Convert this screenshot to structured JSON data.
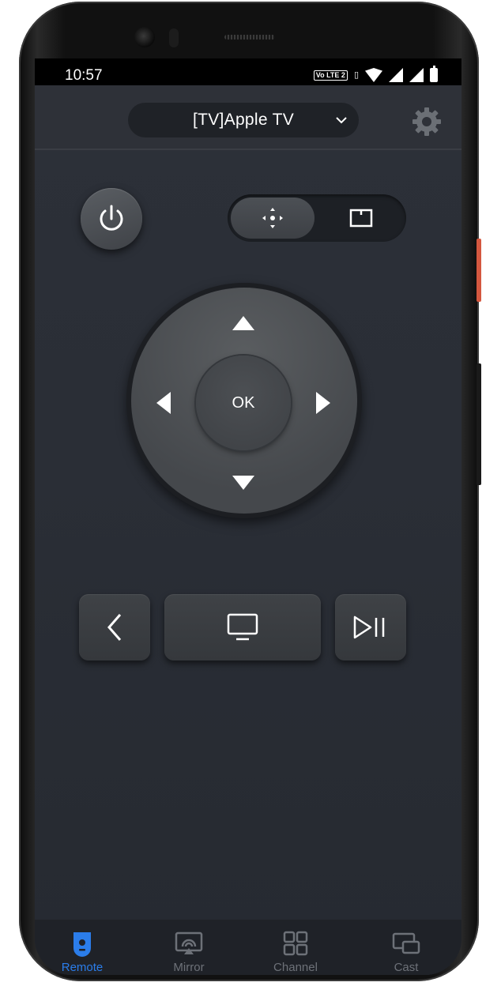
{
  "status_bar": {
    "time": "10:57",
    "volte": "Vo LTE 2"
  },
  "header": {
    "device_name": "[TV]Apple TV"
  },
  "dpad": {
    "ok_label": "OK"
  },
  "tabs": [
    {
      "label": "Remote",
      "active": true,
      "icon": "remote-icon"
    },
    {
      "label": "Mirror",
      "active": false,
      "icon": "mirror-icon"
    },
    {
      "label": "Channel",
      "active": false,
      "icon": "channel-grid-icon"
    },
    {
      "label": "Cast",
      "active": false,
      "icon": "cast-icon"
    }
  ],
  "colors": {
    "accent": "#2b7dea",
    "background": "#262a31",
    "button": "#3f4246"
  }
}
